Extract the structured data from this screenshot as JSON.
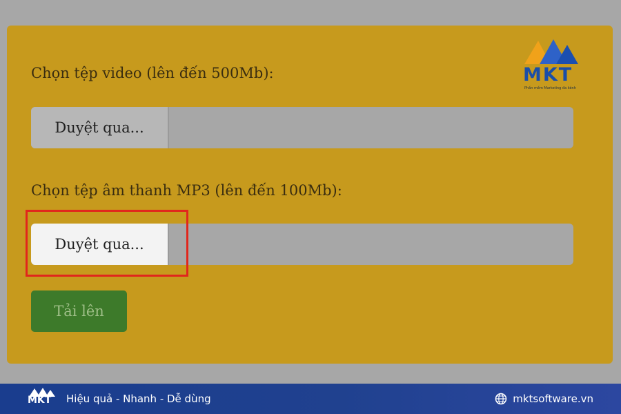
{
  "form": {
    "video_label": "Chọn tệp video (lên đến 500Mb):",
    "video_browse": "Duyệt qua...",
    "audio_label": "Chọn tệp âm thanh MP3 (lên đến 100Mb):",
    "audio_browse": "Duyệt qua...",
    "upload_button": "Tải lên"
  },
  "brand": {
    "logo_text": "MKT",
    "logo_tagline": "Phần mềm Marketing đa kênh",
    "slogan": "Hiệu quả - Nhanh - Dễ dùng",
    "website": "mktsoftware.vn"
  },
  "colors": {
    "panel": "#c79a1d",
    "upload_button": "#3d7a2a",
    "highlight": "#e1261c",
    "footer": "#20418f"
  },
  "icons": {
    "logo": "mkt-logo-icon",
    "website": "globe-icon"
  }
}
